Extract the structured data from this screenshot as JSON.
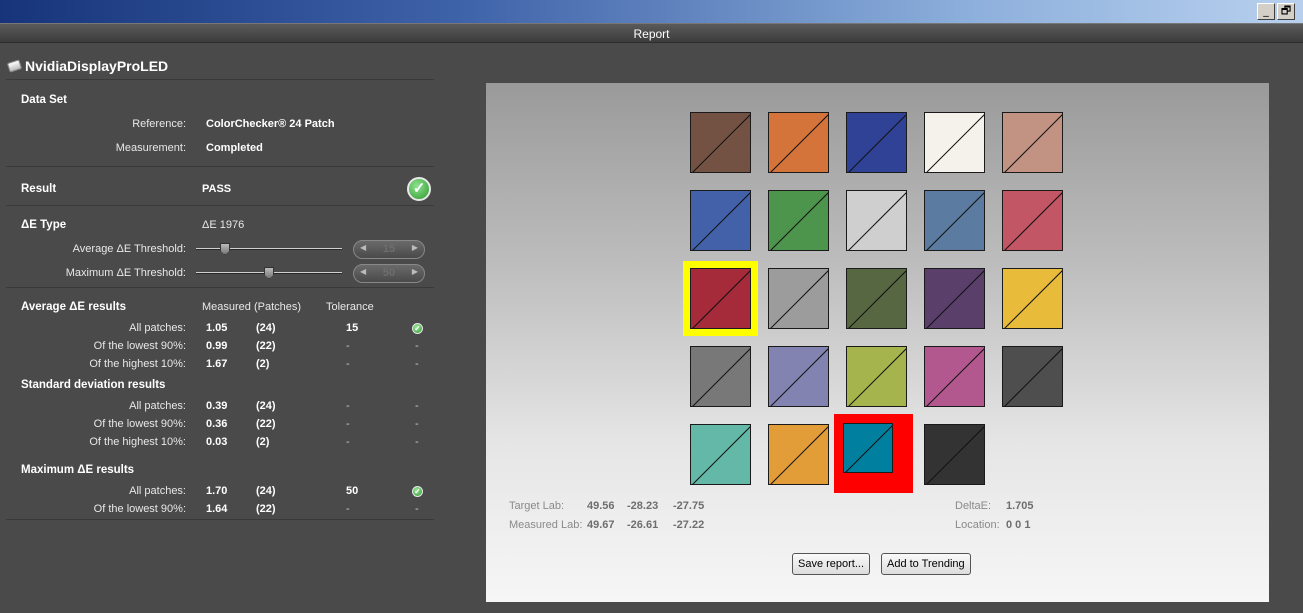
{
  "window": {
    "minimize_glyph": "_",
    "restore_glyph": "🗗"
  },
  "header": {
    "title": "Report"
  },
  "device": {
    "name": "NvidiaDisplayProLED"
  },
  "dataset": {
    "heading": "Data Set",
    "reference_label": "Reference:",
    "reference_value": "ColorChecker® 24 Patch",
    "measurement_label": "Measurement:",
    "measurement_value": "Completed"
  },
  "result": {
    "label": "Result",
    "value": "PASS",
    "status_icon": "check-circle-icon"
  },
  "de_type": {
    "label": "ΔE Type",
    "value": "ΔE 1976",
    "avg_threshold_label": "Average  ΔE Threshold:",
    "avg_threshold_value": "15",
    "avg_threshold_fraction": 0.18,
    "max_threshold_label": "Maximum ΔE Threshold:",
    "max_threshold_value": "50",
    "max_threshold_fraction": 0.5
  },
  "avg_results": {
    "heading": "Average ΔE results",
    "col_measured": "Measured (Patches)",
    "col_tolerance": "Tolerance",
    "rows": [
      {
        "label": "All patches:",
        "value": "1.05",
        "patches": "(24)",
        "tolerance": "15",
        "status": "-",
        "pass": true
      },
      {
        "label": "Of the lowest 90%:",
        "value": "0.99",
        "patches": "(22)",
        "tolerance": "-",
        "status": "-",
        "pass": false
      },
      {
        "label": "Of the highest 10%:",
        "value": "1.67",
        "patches": "(2)",
        "tolerance": "-",
        "status": "-",
        "pass": false
      }
    ]
  },
  "std_results": {
    "heading": "Standard deviation results",
    "rows": [
      {
        "label": "All patches:",
        "value": "0.39",
        "patches": "(24)",
        "tolerance": "-",
        "status": "-"
      },
      {
        "label": "Of the lowest 90%:",
        "value": "0.36",
        "patches": "(22)",
        "tolerance": "-",
        "status": "-"
      },
      {
        "label": "Of the highest 10%:",
        "value": "0.03",
        "patches": "(2)",
        "tolerance": "-",
        "status": "-"
      }
    ]
  },
  "max_results": {
    "heading": "Maximum ΔE results",
    "rows": [
      {
        "label": "All patches:",
        "value": "1.70",
        "patches": "(24)",
        "tolerance": "50",
        "status": "-",
        "pass": true
      },
      {
        "label": "Of the lowest 90%:",
        "value": "1.64",
        "patches": "(22)",
        "tolerance": "-",
        "status": "-",
        "pass": false
      }
    ]
  },
  "patches": {
    "rows": [
      [
        "#735244",
        "#d4733a",
        "#2f4296",
        "#f5f2ec",
        "#c29282"
      ],
      [
        "#4361a8",
        "#4d944d",
        "#cfcfcf",
        "#5b7ca0",
        "#c35664"
      ],
      [
        "#a52a3a",
        "#9c9c9c",
        "#566741",
        "#5a3f6a",
        "#e8bc3a"
      ],
      [
        "#787878",
        "#8283b0",
        "#a5b44c",
        "#b2588e",
        "#4e4e4e"
      ],
      [
        "#64b8a8",
        "#e29c38",
        "#00809e",
        "#333333"
      ]
    ],
    "highlight_yellow": "#ffff00",
    "highlight_red": "#ff0000"
  },
  "lab": {
    "target_label": "Target Lab:",
    "target_L": "49.56",
    "target_a": "-28.23",
    "target_b": "-27.75",
    "measured_label": "Measured Lab:",
    "measured_L": "49.67",
    "measured_a": "-26.61",
    "measured_b": "-27.22",
    "delta_label": "DeltaE:",
    "delta_value": "1.705",
    "location_label": "Location:",
    "location_value": "0 0 1"
  },
  "buttons": {
    "save": "Save report...",
    "trending": "Add to Trending"
  }
}
